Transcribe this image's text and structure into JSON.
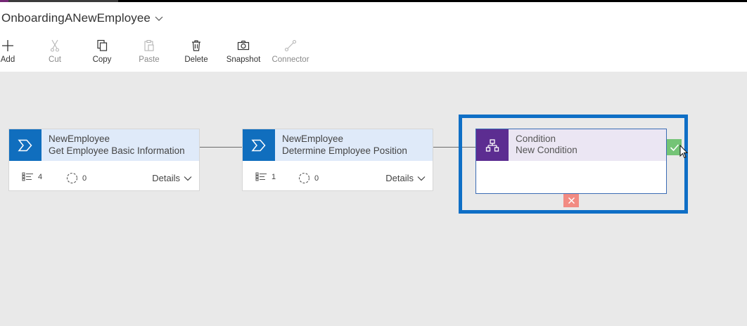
{
  "process": {
    "title": "OnboardingANewEmployee"
  },
  "toolbar": {
    "add": "Add",
    "cut": "Cut",
    "copy": "Copy",
    "paste": "Paste",
    "delete": "Delete",
    "snapshot": "Snapshot",
    "connector": "Connector"
  },
  "stages": [
    {
      "entity": "NewEmployee",
      "name": "Get Employee Basic Information",
      "steps": "4",
      "workflows": "0",
      "details": "Details"
    },
    {
      "entity": "NewEmployee",
      "name": "Determine Employee Position",
      "steps": "1",
      "workflows": "0",
      "details": "Details"
    }
  ],
  "condition": {
    "type": "Condition",
    "name": "New Condition"
  },
  "colors": {
    "stage_icon": "#106ebe",
    "condition_icon": "#5c2d91",
    "selection": "#0f6fc6",
    "yes_branch": "#74c476",
    "no_branch": "#f28b82"
  }
}
